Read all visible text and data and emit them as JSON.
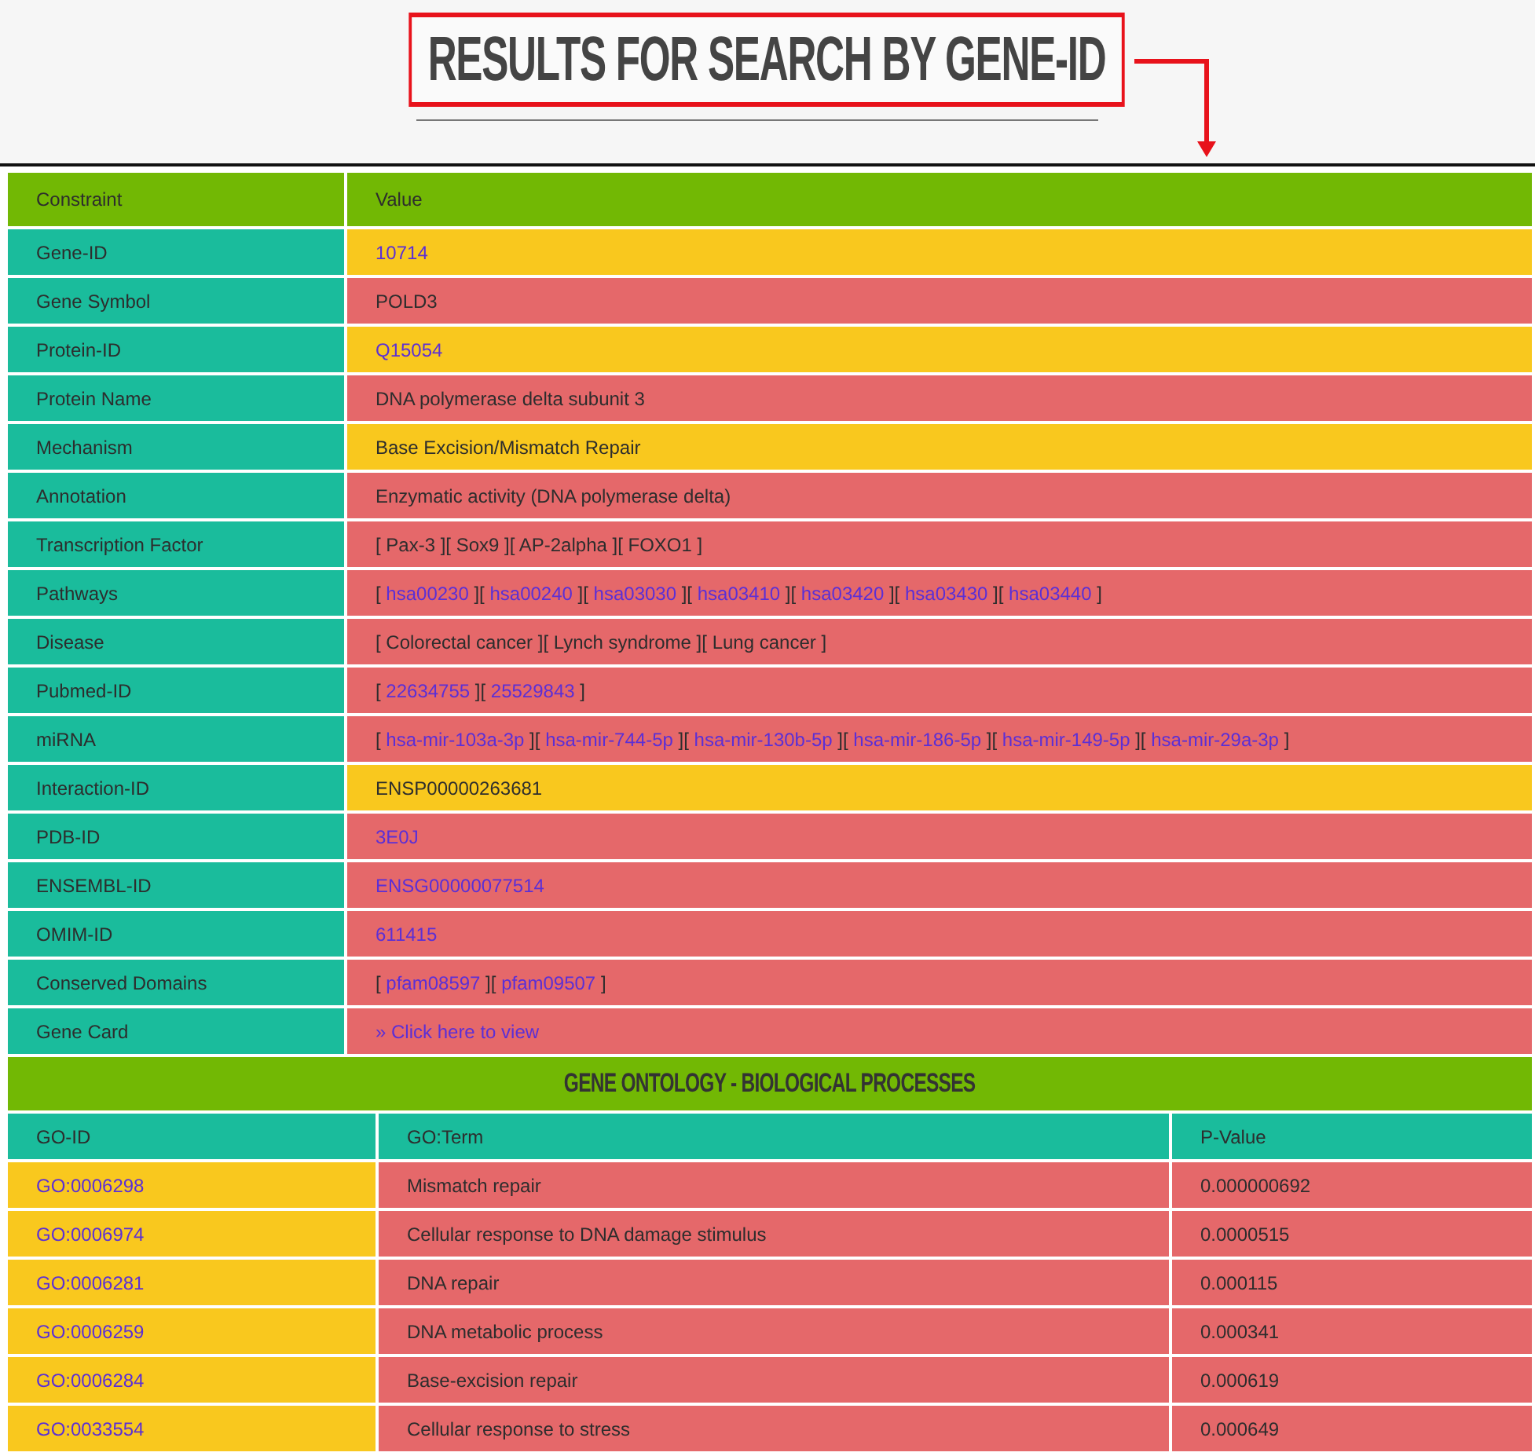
{
  "title": "RESULTS FOR SEARCH BY GENE-ID",
  "details": {
    "columns": [
      "Constraint",
      "Value"
    ],
    "rows": [
      {
        "label": "Gene-ID",
        "color": "#f9c81e",
        "value": [
          {
            "text": "10714",
            "link": true
          }
        ]
      },
      {
        "label": "Gene Symbol",
        "color": "#e5686a",
        "value": [
          {
            "text": "POLD3",
            "link": false
          }
        ]
      },
      {
        "label": "Protein-ID",
        "color": "#f9c81e",
        "value": [
          {
            "text": "Q15054",
            "link": true
          }
        ]
      },
      {
        "label": "Protein Name",
        "color": "#e5686a",
        "value": [
          {
            "text": "DNA polymerase delta subunit 3",
            "link": false
          }
        ]
      },
      {
        "label": "Mechanism",
        "color": "#f9c81e",
        "value": [
          {
            "text": "Base Excision/Mismatch Repair",
            "link": false
          }
        ]
      },
      {
        "label": "Annotation",
        "color": "#e5686a",
        "value": [
          {
            "text": "Enzymatic activity (DNA polymerase delta)",
            "link": false
          }
        ]
      },
      {
        "label": "Transcription Factor",
        "color": "#e5686a",
        "value": [
          {
            "text": "[ Pax-3 ][ Sox9 ][ AP-2alpha ][ FOXO1 ]",
            "link": false
          }
        ]
      },
      {
        "label": "Pathways",
        "color": "#e5686a",
        "value": [
          {
            "text": "[ ",
            "link": false
          },
          {
            "text": "hsa00230",
            "link": true
          },
          {
            "text": " ][ ",
            "link": false
          },
          {
            "text": "hsa00240",
            "link": true
          },
          {
            "text": " ][ ",
            "link": false
          },
          {
            "text": "hsa03030",
            "link": true
          },
          {
            "text": " ][ ",
            "link": false
          },
          {
            "text": "hsa03410",
            "link": true
          },
          {
            "text": " ][ ",
            "link": false
          },
          {
            "text": "hsa03420",
            "link": true
          },
          {
            "text": " ][ ",
            "link": false
          },
          {
            "text": "hsa03430",
            "link": true
          },
          {
            "text": " ][ ",
            "link": false
          },
          {
            "text": "hsa03440",
            "link": true
          },
          {
            "text": " ]",
            "link": false
          }
        ]
      },
      {
        "label": "Disease",
        "color": "#e5686a",
        "value": [
          {
            "text": "[ Colorectal cancer ][ Lynch syndrome ][ Lung cancer ]",
            "link": false
          }
        ]
      },
      {
        "label": "Pubmed-ID",
        "color": "#e5686a",
        "value": [
          {
            "text": "[ ",
            "link": false
          },
          {
            "text": "22634755",
            "link": true
          },
          {
            "text": " ][ ",
            "link": false
          },
          {
            "text": "25529843",
            "link": true
          },
          {
            "text": " ]",
            "link": false
          }
        ]
      },
      {
        "label": "miRNA",
        "color": "#e5686a",
        "value": [
          {
            "text": "[ ",
            "link": false
          },
          {
            "text": "hsa-mir-103a-3p",
            "link": true
          },
          {
            "text": " ][ ",
            "link": false
          },
          {
            "text": "hsa-mir-744-5p",
            "link": true
          },
          {
            "text": " ][ ",
            "link": false
          },
          {
            "text": "hsa-mir-130b-5p",
            "link": true
          },
          {
            "text": " ][ ",
            "link": false
          },
          {
            "text": "hsa-mir-186-5p",
            "link": true
          },
          {
            "text": " ][ ",
            "link": false
          },
          {
            "text": "hsa-mir-149-5p",
            "link": true
          },
          {
            "text": " ][ ",
            "link": false
          },
          {
            "text": "hsa-mir-29a-3p",
            "link": true
          },
          {
            "text": " ]",
            "link": false
          }
        ]
      },
      {
        "label": "Interaction-ID",
        "color": "#f9c81e",
        "value": [
          {
            "text": "ENSP00000263681",
            "link": false
          }
        ]
      },
      {
        "label": "PDB-ID",
        "color": "#e5686a",
        "value": [
          {
            "text": "3E0J",
            "link": true
          }
        ]
      },
      {
        "label": "ENSEMBL-ID",
        "color": "#e5686a",
        "value": [
          {
            "text": "ENSG00000077514",
            "link": true
          }
        ]
      },
      {
        "label": "OMIM-ID",
        "color": "#e5686a",
        "value": [
          {
            "text": "611415",
            "link": true
          }
        ]
      },
      {
        "label": "Conserved Domains",
        "color": "#e5686a",
        "value": [
          {
            "text": "[ ",
            "link": false
          },
          {
            "text": "pfam08597",
            "link": true
          },
          {
            "text": " ][ ",
            "link": false
          },
          {
            "text": "pfam09507",
            "link": true
          },
          {
            "text": " ]",
            "link": false
          }
        ]
      },
      {
        "label": "Gene Card",
        "color": "#e5686a",
        "value": [
          {
            "text": "» Click here to view",
            "link": true
          }
        ]
      }
    ]
  },
  "gene_ontology": {
    "title": "GENE ONTOLOGY - BIOLOGICAL PROCESSES",
    "columns": [
      "GO-ID",
      "GO:Term",
      "P-Value"
    ],
    "rows": [
      {
        "go_id": "GO:0006298",
        "term": "Mismatch repair",
        "p_value": "0.000000692"
      },
      {
        "go_id": "GO:0006974",
        "term": "Cellular response to DNA damage stimulus",
        "p_value": "0.0000515"
      },
      {
        "go_id": "GO:0006281",
        "term": "DNA repair",
        "p_value": "0.000115"
      },
      {
        "go_id": "GO:0006259",
        "term": "DNA metabolic process",
        "p_value": "0.000341"
      },
      {
        "go_id": "GO:0006284",
        "term": "Base-excision repair",
        "p_value": "0.000619"
      },
      {
        "go_id": "GO:0033554",
        "term": "Cellular response to stress",
        "p_value": "0.000649"
      }
    ]
  }
}
